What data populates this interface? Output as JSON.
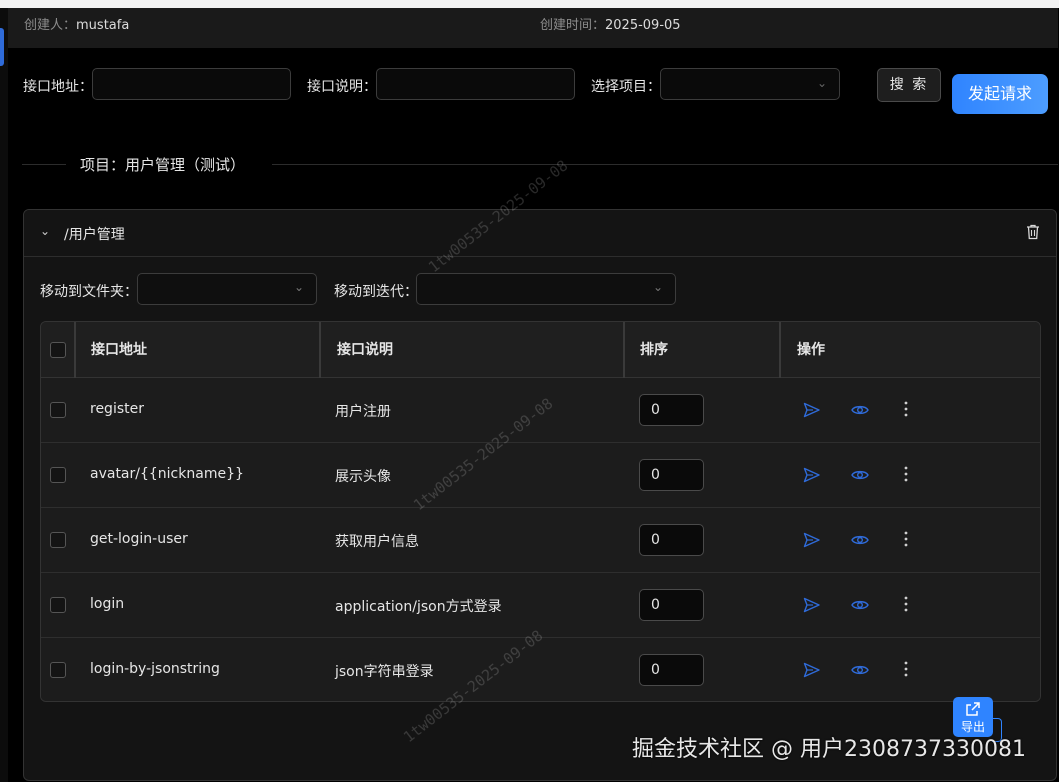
{
  "meta": {
    "creator_label": "创建人：",
    "creator_value": "mustafa",
    "created_label": "创建时间：",
    "created_value": "2025-09-05"
  },
  "filters": {
    "api_address_label": "接口地址：",
    "api_address_value": "",
    "api_desc_label": "接口说明：",
    "api_desc_value": "",
    "project_label": "选择项目：",
    "project_value": "",
    "search_button": "搜 索",
    "send_button": "发起请求"
  },
  "project": {
    "divider_title": "项目：用户管理（测试）"
  },
  "folder": {
    "title": "/用户管理",
    "move_folder_label": "移动到文件夹：",
    "move_iteration_label": "移动到迭代："
  },
  "table": {
    "columns": [
      "接口地址",
      "接口说明",
      "排序",
      "操作"
    ],
    "rows": [
      {
        "address": "register",
        "desc": "用户注册",
        "order": "0"
      },
      {
        "address": "avatar/{{nickname}}",
        "desc": "展示头像",
        "order": "0"
      },
      {
        "address": "get-login-user",
        "desc": "获取用户信息",
        "order": "0"
      },
      {
        "address": "login",
        "desc": "application/json方式登录",
        "order": "0"
      },
      {
        "address": "login-by-jsonstring",
        "desc": "json字符串登录",
        "order": "0"
      }
    ]
  },
  "export": {
    "label": "导出"
  },
  "overlay": {
    "juejin_watermark": "掘金技术社区 @ 用户2308737330081",
    "diagonal_watermark": "1tw00535-2025-09-08"
  },
  "colors": {
    "accent": "#2f84ff",
    "icon_blue": "#2f6bd9",
    "background": "#000000",
    "panel": "#141414"
  }
}
